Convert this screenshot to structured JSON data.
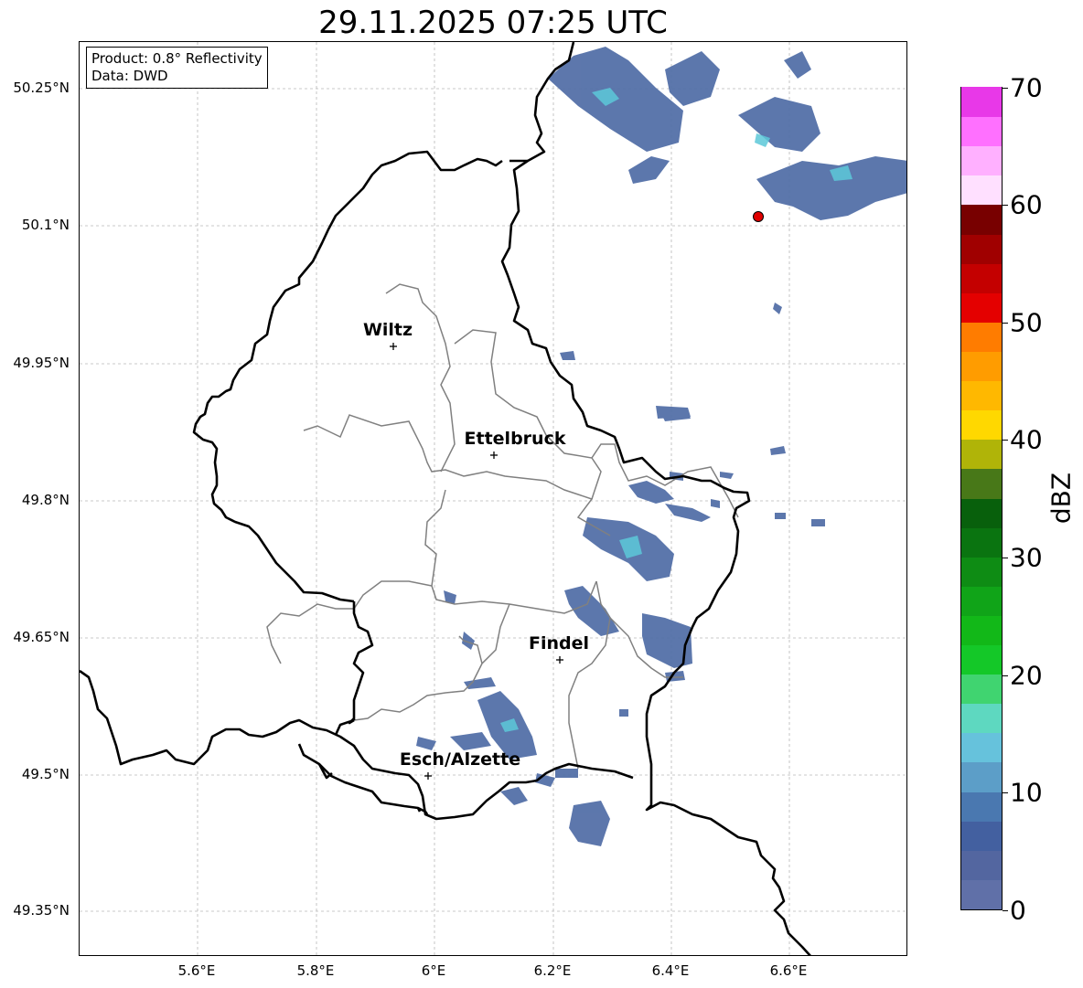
{
  "title": "29.11.2025 07:25 UTC",
  "info": {
    "product": "Product: 0.8° Reflectivity",
    "data": "Data: DWD"
  },
  "latitude_labels": [
    "50.25°N",
    "50.1°N",
    "49.95°N",
    "49.8°N",
    "49.65°N",
    "49.5°N",
    "49.35°N"
  ],
  "longitude_labels": [
    "5.6°E",
    "5.8°E",
    "6°E",
    "6.2°E",
    "6.4°E",
    "6.6°E"
  ],
  "cities": [
    {
      "name": "Wiltz"
    },
    {
      "name": "Ettelbruck"
    },
    {
      "name": "Findel"
    },
    {
      "name": "Esch/Alzette"
    }
  ],
  "colorbar": {
    "label": "dBZ",
    "ticks": [
      "0",
      "10",
      "20",
      "30",
      "40",
      "50",
      "60",
      "70"
    ],
    "colors": [
      "#6070a8",
      "#5366a0",
      "#4360a0",
      "#4a78b0",
      "#5c9ec8",
      "#66c2dc",
      "#5ed8c0",
      "#40d470",
      "#14c828",
      "#12b818",
      "#10a418",
      "#0e8c14",
      "#0a7410",
      "#08600c",
      "#487818",
      "#b0b408",
      "#ffd800",
      "#ffb800",
      "#ff9c00",
      "#ff7c00",
      "#e40000",
      "#c40000",
      "#a00000",
      "#780000",
      "#ffe0ff",
      "#ffb0ff",
      "#ff70ff",
      "#e838e8"
    ]
  },
  "colors": {
    "border": "#000000",
    "canton_border": "#808080",
    "radar_low": "#5470a8",
    "radar_mid": "#5cc8d8",
    "radar_site": "#e00000"
  }
}
